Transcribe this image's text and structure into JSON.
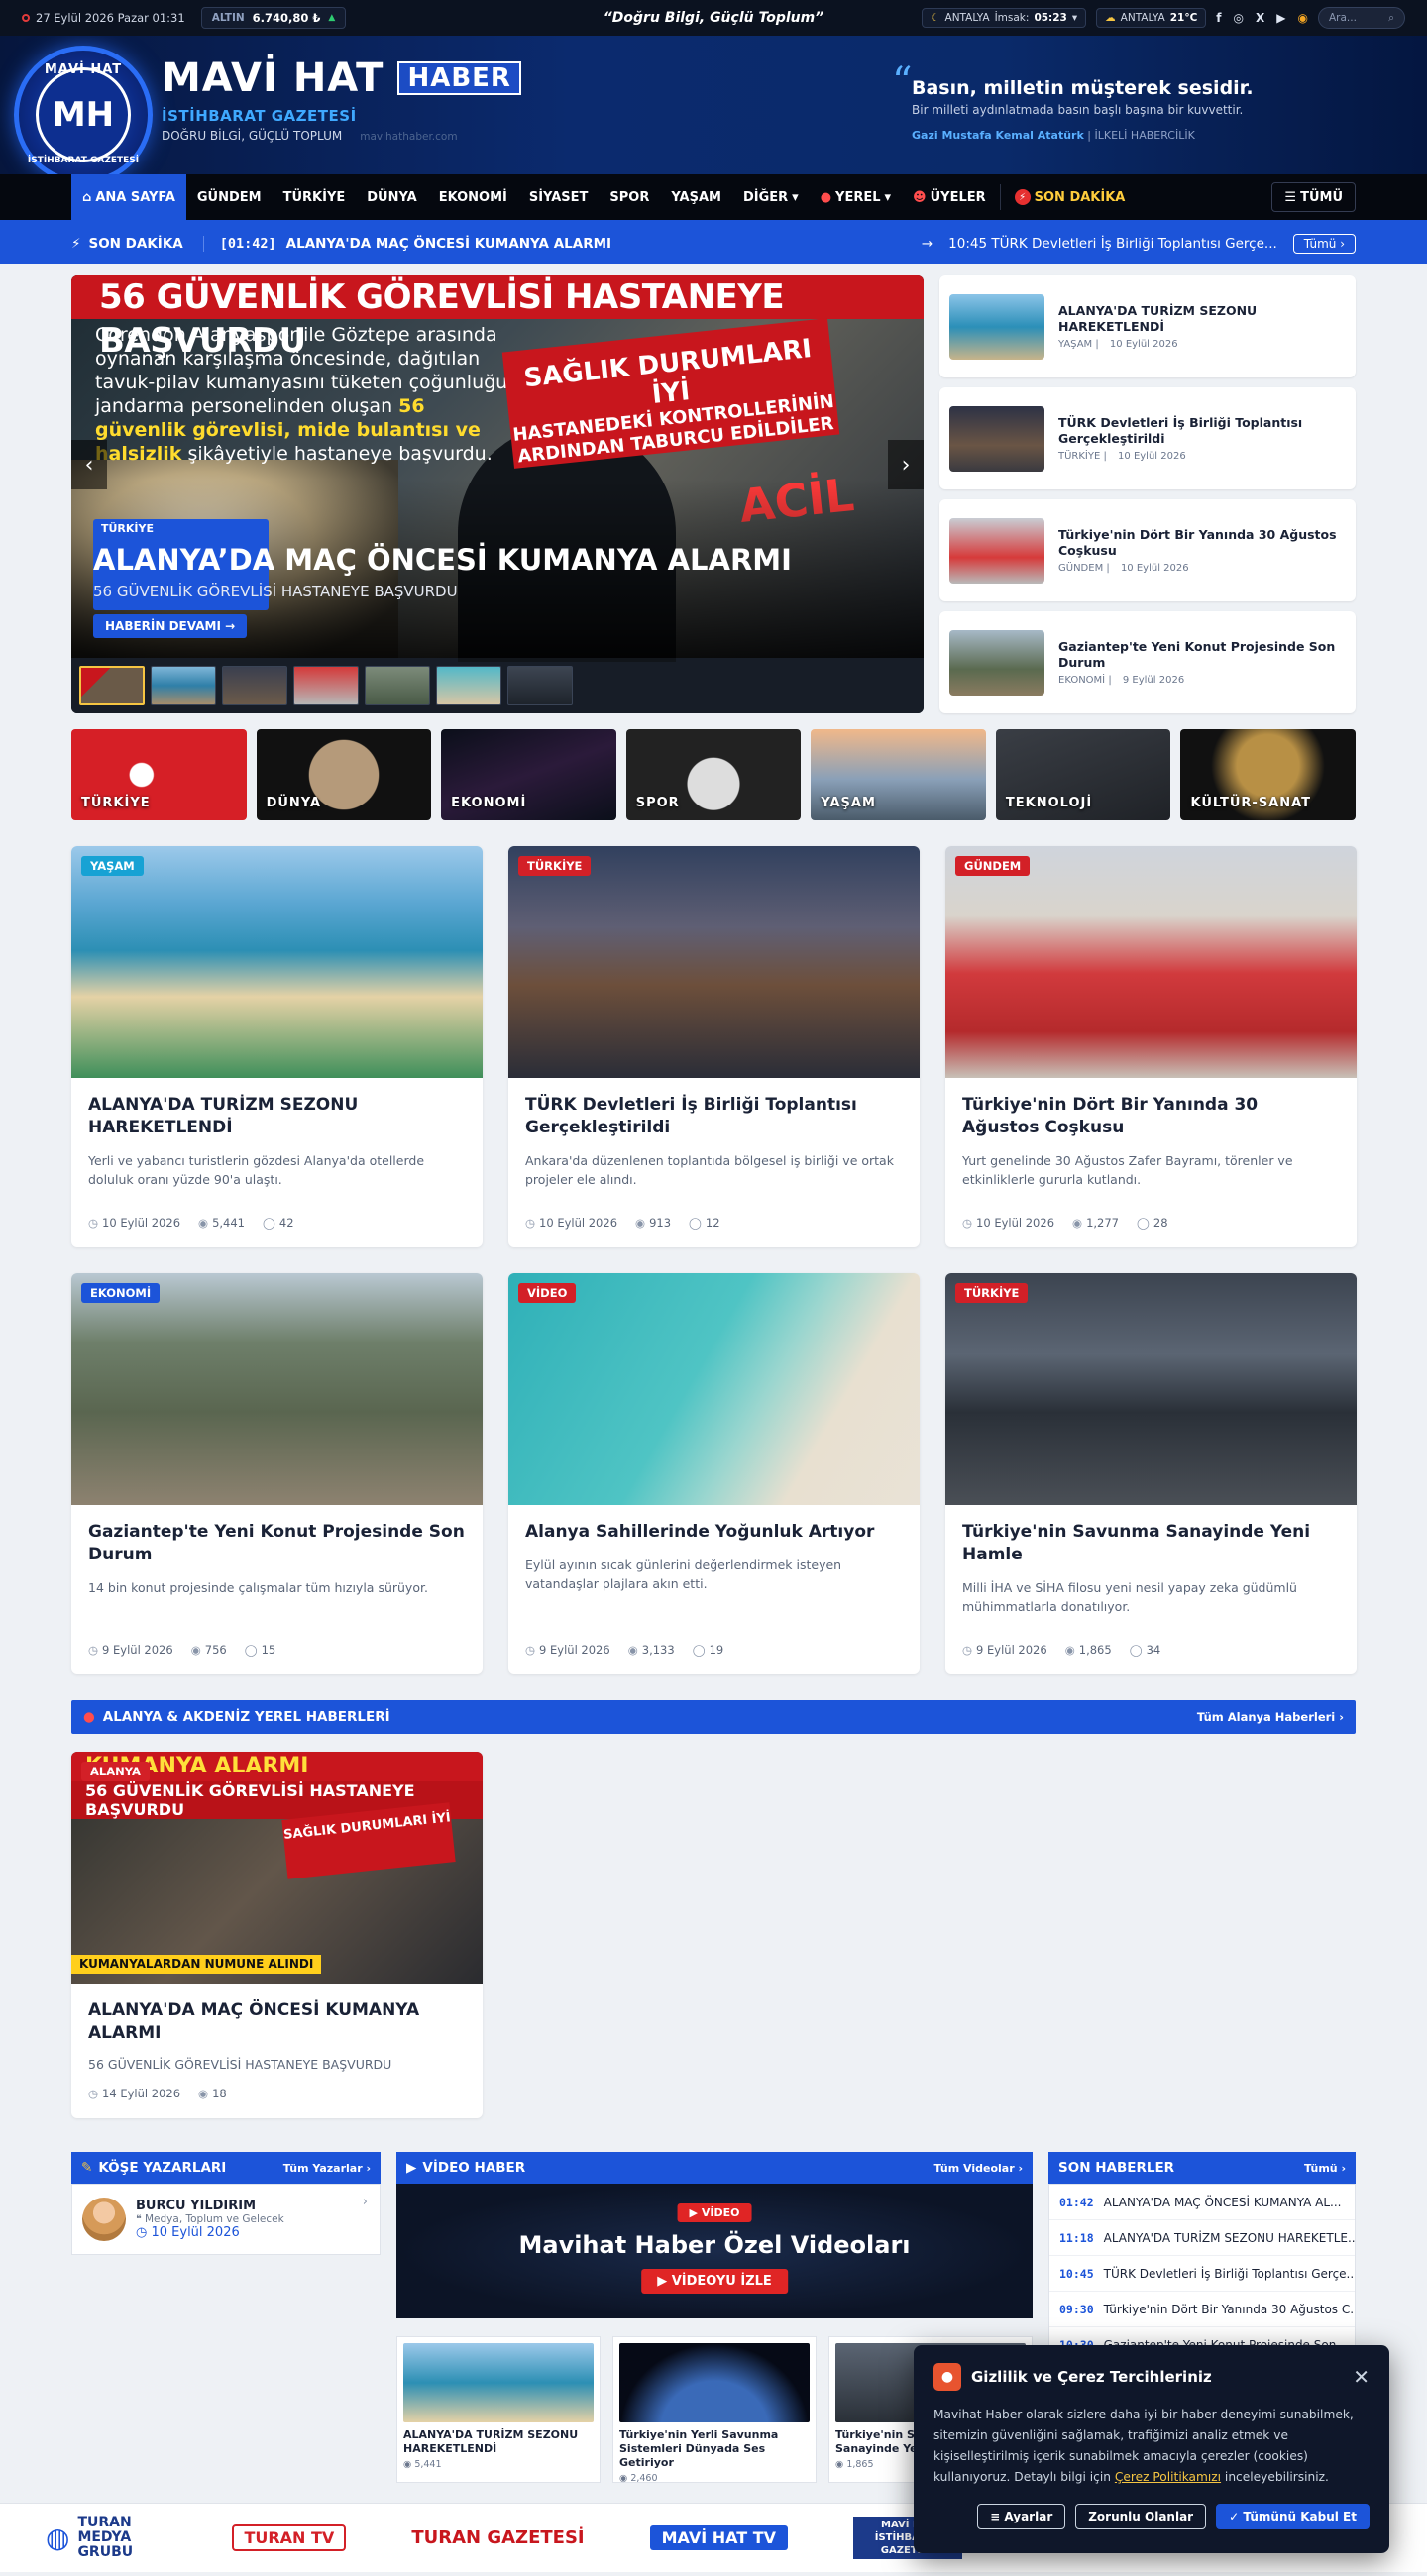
{
  "topbar": {
    "date": "27 Eylül 2026 Pazar 01:31",
    "gold_label": "ALTIN",
    "gold_value": "6.740,80 ₺",
    "slogan": "“Doğru Bilgi, Güçlü Toplum”",
    "prayer_city": "ANTALYA",
    "prayer_label": "İmsak:",
    "prayer_time": "05:23",
    "weather_city": "ANTALYA",
    "weather_temp": "21°C",
    "search_placeholder": "Ara..."
  },
  "header": {
    "logo_top": "MAVİ HAT",
    "logo_bottom": "İSTİHBARAT GAZETESİ",
    "logo_mono": "MH",
    "brand": "MAVİ HAT",
    "brand_tag": "HABER",
    "sub1": "İSTİHBARAT GAZETESİ",
    "sub2": "DOĞRU BİLGİ, GÜÇLÜ TOPLUM",
    "site": "mavihathaber.com",
    "quote1": "Basın, milletin müşterek sesidir.",
    "quote2": "Bir milleti aydınlatmada basın başlı başına bir kuvvettir.",
    "quote_author": "Gazi Mustafa Kemal Atatürk",
    "quote_tag": "İLKELİ HABERCİLİK"
  },
  "nav": {
    "items": [
      "ANA SAYFA",
      "GÜNDEM",
      "TÜRKİYE",
      "DÜNYA",
      "EKONOMİ",
      "SİYASET",
      "SPOR",
      "YAŞAM",
      "DİĞER",
      "YEREL",
      "ÜYELER",
      "SON DAKİKA"
    ],
    "all": "TÜMÜ"
  },
  "breaking": {
    "label": "SON DAKİKA",
    "time": "[01:42]",
    "text": "ALANYA'DA MAÇ ÖNCESİ KUMANYA ALARMI",
    "right": "10:45 TÜRK Devletleri İş Birliği Toplantısı Gerçe...",
    "all": "Tümü"
  },
  "hero": {
    "red_head": "56 GÜVENLİK GÖREVLİSİ HASTANEYE BAŞVURDU",
    "body_a": "Corendon Alanyaspor ile Göztepe arasında oynanan karşılaşma öncesinde, dağıtılan tavuk-pilav kumanyasını tüketen çoğunluğu jandarma personelinden oluşan ",
    "body_b": "56 güvenlik görevlisi, mide bulantısı ve halsizlik",
    "body_c": " şikâyetiyle hastaneye başvurdu.",
    "stamp1": "SAĞLIK DURUMLARI İYİ",
    "stamp2": "HASTANEDEKİ KONTROLLERİNİN ARDINDAN TABURCU EDİLDİLER",
    "acil": "ACİL",
    "category": "TÜRKİYE",
    "title": "ALANYA’DA MAÇ ÖNCESİ KUMANYA ALARMI",
    "subtitle": "56 GÜVENLİK GÖREVLİSİ HASTANEYE BAŞVURDU",
    "button": "HABERİN DEVAMI →"
  },
  "side": [
    {
      "title": "ALANYA'DA TURİZM SEZONU HAREKETLENDİ",
      "cat": "YAŞAM",
      "date": "10 Eylül 2026"
    },
    {
      "title": "TÜRK Devletleri İş Birliği Toplantısı Gerçekleştirildi",
      "cat": "TÜRKİYE",
      "date": "10 Eylül 2026"
    },
    {
      "title": "Türkiye'nin Dört Bir Yanında 30 Ağustos Coşkusu",
      "cat": "GÜNDEM",
      "date": "10 Eylül 2026"
    },
    {
      "title": "Gaziantep'te Yeni Konut Projesinde Son Durum",
      "cat": "EKONOMİ",
      "date": "9 Eylül 2026"
    }
  ],
  "categories": [
    "TÜRKİYE",
    "DÜNYA",
    "EKONOMİ",
    "SPOR",
    "YAŞAM",
    "TEKNOLOJİ",
    "KÜLTÜR-SANAT"
  ],
  "cards": [
    {
      "badge": "YAŞAM",
      "title": "ALANYA'DA TURİZM SEZONU HAREKETLENDİ",
      "desc": "Yerli ve yabancı turistlerin gözdesi Alanya'da otellerde doluluk oranı yüzde 90'a ulaştı.",
      "date": "10 Eylül 2026",
      "views": "5,441",
      "comments": "42"
    },
    {
      "badge": "TÜRKİYE",
      "title": "TÜRK Devletleri İş Birliği Toplantısı Gerçekleştirildi",
      "desc": "Ankara'da düzenlenen toplantıda bölgesel iş birliği ve ortak projeler ele alındı.",
      "date": "10 Eylül 2026",
      "views": "913",
      "comments": "12"
    },
    {
      "badge": "GÜNDEM",
      "title": "Türkiye'nin Dört Bir Yanında 30 Ağustos Coşkusu",
      "desc": "Yurt genelinde 30 Ağustos Zafer Bayramı, törenler ve etkinliklerle gururla kutlandı.",
      "date": "10 Eylül 2026",
      "views": "1,277",
      "comments": "28"
    },
    {
      "badge": "EKONOMİ",
      "title": "Gaziantep'te Yeni Konut Projesinde Son Durum",
      "desc": "14 bin konut projesinde çalışmalar tüm hızıyla sürüyor.",
      "date": "9 Eylül 2026",
      "views": "756",
      "comments": "15"
    },
    {
      "badge": "VİDEO",
      "title": "Alanya Sahillerinde Yoğunluk Artıyor",
      "desc": "Eylül ayının sıcak günlerini değerlendirmek isteyen vatandaşlar plajlara akın etti.",
      "date": "9 Eylül 2026",
      "views": "3,133",
      "comments": "19"
    },
    {
      "badge": "TÜRKİYE",
      "title": "Türkiye'nin Savunma Sanayinde Yeni Hamle",
      "desc": "Milli İHA ve SİHA filosu yeni nesil yapay zeka güdümlü mühimmatlarla donatılıyor.",
      "date": "9 Eylül 2026",
      "views": "1,865",
      "comments": "34"
    }
  ],
  "local": {
    "section": "ALANYA & AKDENİZ YEREL HABERLERİ",
    "all": "Tüm Alanya Haberleri",
    "badge": "ALANYA",
    "img_head": "KUMANYA ALARMI",
    "img_sub": "56 GÜVENLİK GÖREVLİSİ HASTANEYE BAŞVURDU",
    "img_stamp": "SAĞLIK DURUMLARI İYİ",
    "img_yellow": "KUMANYALARDAN NUMUNE ALINDI",
    "title": "ALANYA'DA MAÇ ÖNCESİ KUMANYA ALARMI",
    "desc": "56 GÜVENLİK GÖREVLİSİ HASTANEYE BAŞVURDU",
    "date": "14 Eylül 2026",
    "views": "18"
  },
  "writers": {
    "title": "KÖŞE YAZARLARI",
    "all": "Tüm Yazarlar",
    "name": "BURCU YILDIRIM",
    "topic": "Medya, Toplum ve Gelecek",
    "date": "10 Eylül 2026"
  },
  "video": {
    "title": "VİDEO HABER",
    "all": "Tüm Videolar",
    "tag": "VİDEO",
    "headline": "Mavihat Haber Özel Videoları",
    "button": "VİDEOYU İZLE",
    "thumbs": [
      {
        "title": "ALANYA'DA TURİZM SEZONU HAREKETLENDİ",
        "views": "5,441"
      },
      {
        "title": "Türkiye'nin Yerli Savunma Sistemleri Dünyada Ses Getiriyor",
        "views": "2,460"
      },
      {
        "title": "Türkiye'nin Savunma Sanayinde Yeni Hamle",
        "views": "1,865"
      }
    ]
  },
  "latest": {
    "title": "SON HABERLER",
    "all": "Tümü",
    "rows": [
      {
        "time": "01:42",
        "text": "ALANYA'DA MAÇ ÖNCESİ KUMANYA AL..."
      },
      {
        "time": "11:18",
        "text": "ALANYA'DA TURİZM SEZONU HAREKETLE..."
      },
      {
        "time": "10:45",
        "text": "TÜRK Devletleri İş Birliği Toplantısı Gerçe..."
      },
      {
        "time": "09:30",
        "text": "Türkiye'nin Dört Bir Yanında 30 Ağustos C..."
      },
      {
        "time": "10:30",
        "text": "Gaziantep'te Yeni Konut Projesinde Son..."
      }
    ]
  },
  "footer": [
    "TURAN MEDYA GRUBU",
    "TURAN TV",
    "TURAN GAZETESİ",
    "MAVİ HAT TV",
    "MAVİ HAT İSTİHBARAT GAZETESİ"
  ],
  "cookie": {
    "title": "Gizlilik ve Çerez Tercihleriniz",
    "text": "Mavihat Haber olarak sizlere daha iyi bir haber deneyimi sunabilmek, sitemizin güvenliğini sağlamak, trafiğimizi analiz etmek ve kişiselleştirilmiş içerik sunabilmek amacıyla çerezler (cookies) kullanıyoruz. Detaylı bilgi için ",
    "link": "Çerez Politikamızı",
    "text2": " inceleyebilirsiniz.",
    "settings": "Ayarlar",
    "required": "Zorunlu Olanlar",
    "accept": "Tümünü Kabul Et"
  }
}
